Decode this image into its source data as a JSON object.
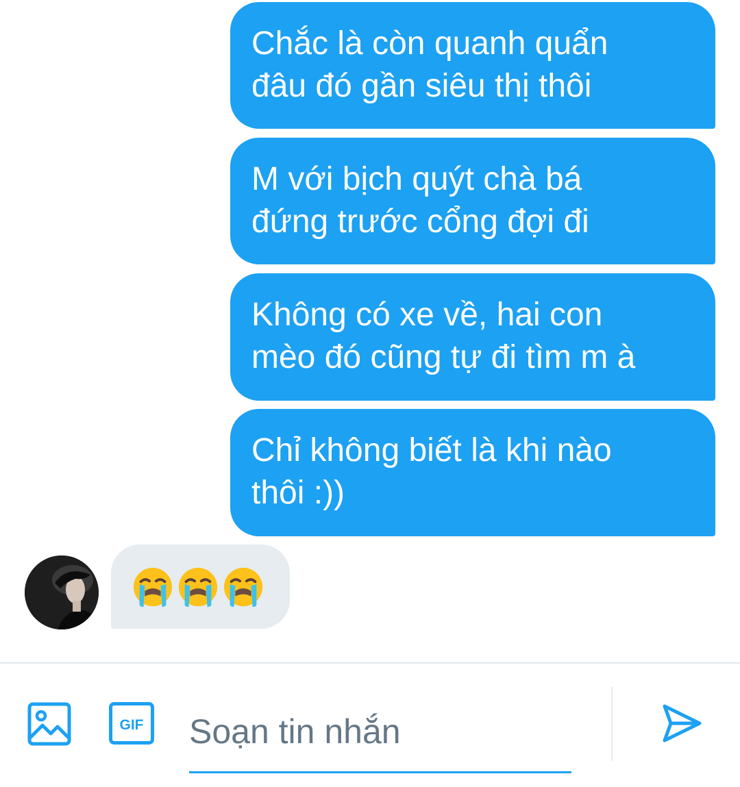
{
  "messages": [
    {
      "from": "me",
      "text": "Chắc là còn quanh quẩn\nđâu đó gần siêu thị thôi"
    },
    {
      "from": "me",
      "text": "M với bịch quýt chà bá\nđứng trước cổng đợi đi"
    },
    {
      "from": "me",
      "text": "Không có xe về, hai con\nmèo đó cũng tự đi tìm m à"
    },
    {
      "from": "me",
      "text": "Chỉ không biết là khi nào\nthôi :))"
    }
  ],
  "reply": {
    "emojis": [
      "loudly-crying-face",
      "loudly-crying-face",
      "loudly-crying-face"
    ]
  },
  "composer": {
    "placeholder": "Soạn tin nhắn",
    "gif_label": "GIF"
  },
  "colors": {
    "accent": "#1da1f2",
    "incoming_bubble": "#e6ecf0",
    "placeholder": "#657786"
  }
}
